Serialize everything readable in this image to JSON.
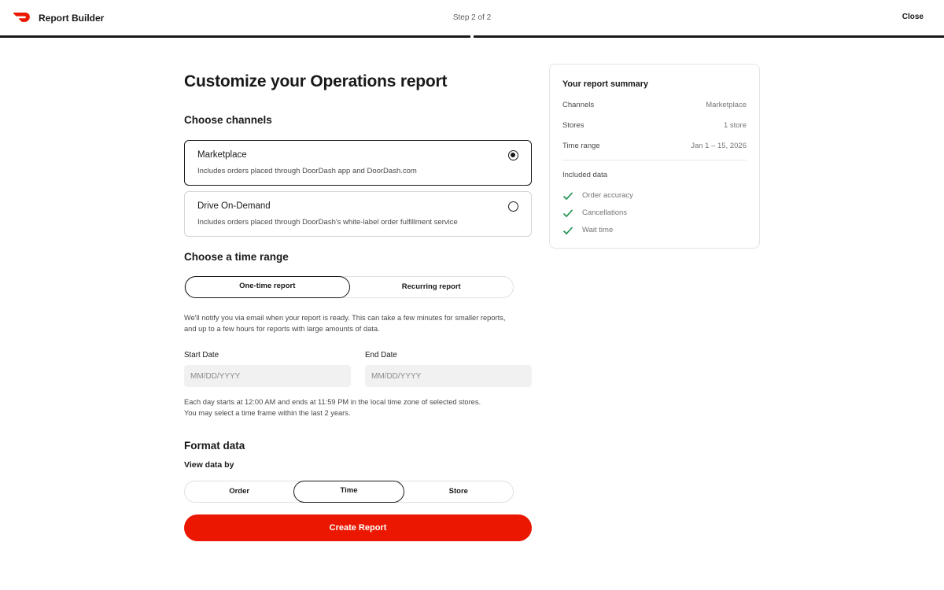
{
  "header": {
    "app_title": "Report Builder",
    "step": "Step 2 of 2",
    "close_label": "Close",
    "brand_color": "#eb1700"
  },
  "main": {
    "title": "Customize your Operations report",
    "channels": {
      "heading": "Choose channels",
      "options": [
        {
          "name": "Marketplace",
          "description": "Includes orders placed through DoorDash app and DoorDash.com",
          "selected": true
        },
        {
          "name": "Drive On-Demand",
          "description": "Includes orders placed through DoorDash's white-label order fulfillment service",
          "selected": false
        }
      ]
    },
    "time_range": {
      "heading": "Choose a time range",
      "options": [
        "One-time report",
        "Recurring report"
      ],
      "selected": "One-time report",
      "notify_note": "We'll notify you via email when your report is ready. This can take a few minutes for smaller reports, and up to a few hours for reports with large amounts of data.",
      "start_label": "Start Date",
      "start_placeholder": "MM/DD/YYYY",
      "end_label": "End Date",
      "end_placeholder": "MM/DD/YYYY",
      "day_note_1": "Each day starts at 12:00 AM and ends at 11:59 PM in the local time zone of selected stores.",
      "day_note_2": "You may select a time frame within the last 2 years."
    },
    "format": {
      "heading": "Format data",
      "view_by_label": "View data by",
      "options": [
        "Order",
        "Time",
        "Store"
      ],
      "selected": "Time"
    },
    "create_button": "Create Report"
  },
  "summary": {
    "title": "Your report summary",
    "rows": [
      {
        "key": "Channels",
        "value": "Marketplace"
      },
      {
        "key": "Stores",
        "value": "1 store"
      },
      {
        "key": "Time range",
        "value": "Jan 1 – 15, 2026"
      }
    ],
    "included_label": "Included data",
    "included": [
      "Order accuracy",
      "Cancellations",
      "Wait time"
    ],
    "check_color": "#1f8f4e"
  }
}
